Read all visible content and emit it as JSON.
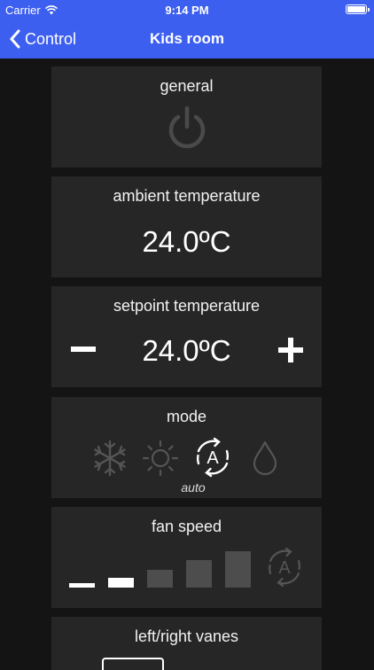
{
  "status_bar": {
    "carrier": "Carrier",
    "time": "9:14 PM",
    "wifi_icon": "wifi-icon",
    "battery_icon": "battery-icon"
  },
  "nav": {
    "back_label": "Control",
    "title": "Kids room",
    "back_icon": "chevron-left-icon"
  },
  "general": {
    "title": "general",
    "power_icon": "power-icon"
  },
  "ambient": {
    "title": "ambient temperature",
    "value": "24.0ºC"
  },
  "setpoint": {
    "title": "setpoint temperature",
    "value": "24.0ºC",
    "minus_icon": "minus-icon",
    "plus_icon": "plus-icon"
  },
  "mode": {
    "title": "mode",
    "selected_label": "auto",
    "icons": [
      "snowflake-icon",
      "sun-icon",
      "auto-mode-icon",
      "water-drop-icon"
    ]
  },
  "fan_speed": {
    "title": "fan speed",
    "levels": 5,
    "auto_icon": "auto-fan-icon"
  },
  "vanes": {
    "title": "left/right vanes"
  },
  "colors": {
    "accent": "#3d5ff0",
    "card_bg": "#262626",
    "page_bg": "#141414",
    "inactive_icon": "#555555"
  }
}
